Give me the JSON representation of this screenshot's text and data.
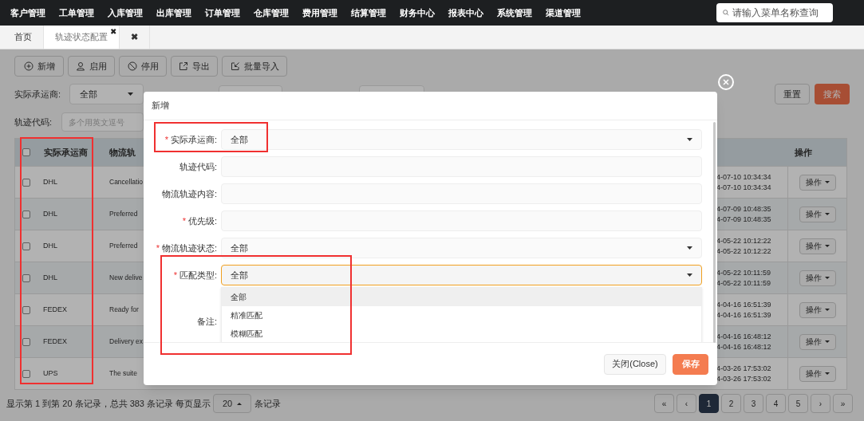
{
  "top_menu": [
    "客户管理",
    "工单管理",
    "入库管理",
    "出库管理",
    "订单管理",
    "仓库管理",
    "费用管理",
    "结算管理",
    "财务中心",
    "报表中心",
    "系统管理",
    "渠道管理"
  ],
  "menu_search": {
    "placeholder": "请输入菜单名称查询"
  },
  "tabs": [
    {
      "label": "首页",
      "selected": false
    },
    {
      "label": "轨迹状态配置",
      "selected": true,
      "close": "✖"
    },
    {
      "label": "✖",
      "selected": false
    }
  ],
  "toolbar": [
    {
      "label": "新增"
    },
    {
      "label": "启用"
    },
    {
      "label": "停用"
    },
    {
      "label": "导出"
    },
    {
      "label": "批量导入"
    }
  ],
  "filters": {
    "carrier_label": "实际承运商:",
    "carrier_value": "全部",
    "code_label": "轨迹代码:",
    "code_placeholder": "多个用英文逗号",
    "reset": "重置",
    "search": "搜索"
  },
  "table": {
    "header_checked": false,
    "columns": [
      "实际承运商",
      "物流轨",
      "",
      "操作"
    ],
    "rows": [
      {
        "checked": false,
        "carrier": "DHL",
        "content": "Cancellatio",
        "times": [
          "4-07-10 10:34:34",
          "4-07-10 10:34:34"
        ],
        "action": "操作"
      },
      {
        "checked": false,
        "carrier": "DHL",
        "content": "Preferred",
        "times": [
          "4-07-09 10:48:35",
          "4-07-09 10:48:35"
        ],
        "action": "操作"
      },
      {
        "checked": false,
        "carrier": "DHL",
        "content": "Preferred",
        "times": [
          "4-05-22 10:12:22",
          "4-05-22 10:12:22"
        ],
        "action": "操作"
      },
      {
        "checked": false,
        "carrier": "DHL",
        "content": "New delive",
        "times": [
          "4-05-22 10:11:59",
          "4-05-22 10:11:59"
        ],
        "action": "操作"
      },
      {
        "checked": false,
        "carrier": "FEDEX",
        "content": "Ready for",
        "times": [
          "4-04-16 16:51:39",
          "4-04-16 16:51:39"
        ],
        "action": "操作"
      },
      {
        "checked": false,
        "carrier": "FEDEX",
        "content": "Delivery ex",
        "times": [
          "4-04-16 16:48:12",
          "4-04-16 16:48:12"
        ],
        "action": "操作"
      },
      {
        "checked": false,
        "carrier": "UPS",
        "content": "The suite",
        "times": [
          "4-03-26 17:53:02",
          "4-03-26 17:53:02"
        ],
        "action": "操作"
      }
    ]
  },
  "pagination": {
    "summary": "显示第 1 到第 20 条记录，总共 383 条记录 每页显示",
    "page_size": "20",
    "suffix": "条记录",
    "pages": [
      {
        "label": "«",
        "selected": false
      },
      {
        "label": "‹",
        "selected": false
      },
      {
        "label": "1",
        "selected": true
      },
      {
        "label": "2",
        "selected": false
      },
      {
        "label": "3",
        "selected": false
      },
      {
        "label": "4",
        "selected": false
      },
      {
        "label": "5",
        "selected": false
      },
      {
        "label": "›",
        "selected": false
      },
      {
        "label": "»",
        "selected": false
      }
    ]
  },
  "dialog": {
    "title": "新增",
    "fields": [
      {
        "kind": "select",
        "label": "实际承运商:",
        "required_mark": "*",
        "value": "全部",
        "focused": false
      },
      {
        "kind": "input",
        "label": "轨迹代码:"
      },
      {
        "kind": "input",
        "label": "物流轨迹内容:"
      },
      {
        "kind": "input",
        "label": "优先级:",
        "required_mark": "*"
      },
      {
        "kind": "select",
        "label": "物流轨迹状态:",
        "required_mark": "*",
        "value": "全部",
        "focused": false
      },
      {
        "kind": "select",
        "label": "匹配类型:",
        "required_mark": "*",
        "value": "全部",
        "focused": true,
        "expanded": true,
        "options": [
          {
            "label": "全部",
            "highlighted": true
          },
          {
            "label": "精准匹配",
            "highlighted": false
          },
          {
            "label": "模糊匹配",
            "highlighted": false
          }
        ]
      },
      {
        "kind": "textarea",
        "label": "备注:"
      }
    ],
    "buttons": [
      {
        "label": "关闭(Close)",
        "kind": "default"
      },
      {
        "label": "保存",
        "kind": "primary"
      }
    ]
  }
}
